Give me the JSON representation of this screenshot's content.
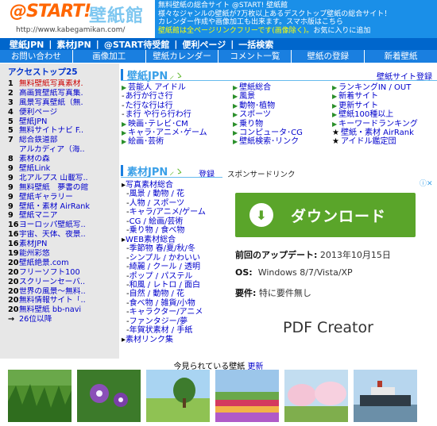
{
  "header": {
    "logo_start": "@START!",
    "logo_kanji": "壁紙館",
    "url": "http://www.kabegamikan.com/",
    "info_lines": [
      "無料壁紙の総合サイト @START! 壁紙館",
      "様々なジャンルの壁紙が7万枚以上あるデスクトップ壁紙の総合サイト！",
      "カレンダー作成や画像加工も出来ます。スマホ版はこちら"
    ],
    "info_line4_hl": "壁紙館は全ページリンクフリーです(画像除く)。",
    "info_line4_rest": "お気に入りに追加"
  },
  "nav1": [
    "壁紙JPN",
    "素材JPN",
    "@START待受館",
    "便利ページ",
    "一括検索"
  ],
  "nav2": [
    "お問い合わせ",
    "画像加工",
    "壁紙カレンダー",
    "コメント一覧",
    "壁紙の登録",
    "新着壁紙"
  ],
  "sidebar": {
    "title": "アクセストップ25",
    "items": [
      {
        "n": "1",
        "t": "無料壁紙写真素材."
      },
      {
        "n": "2",
        "t": "高画質壁紙写真集."
      },
      {
        "n": "3",
        "t": "風景写真壁紙（無."
      },
      {
        "n": "4",
        "t": "便利ページ"
      },
      {
        "n": "5",
        "t": "壁紙JPN"
      },
      {
        "n": "5",
        "t": "無料サイトナビ F.."
      },
      {
        "n": "7",
        "t": "総合鉄道部"
      },
      {
        "n": "",
        "t": "アルカディア（海.."
      },
      {
        "n": "8",
        "t": "素材の森"
      },
      {
        "n": "9",
        "t": "壁紙Link"
      },
      {
        "n": "9",
        "t": "北アルプス 山載写.."
      },
      {
        "n": "9",
        "t": "無料壁紙　夢書の館"
      },
      {
        "n": "9",
        "t": "壁紙ギャラリー"
      },
      {
        "n": "9",
        "t": "壁紙・素材 AirRank"
      },
      {
        "n": "9",
        "t": "壁紙マニア"
      },
      {
        "n": "16",
        "t": "ヨーロッパ壁紙写.."
      },
      {
        "n": "16",
        "t": "宇宙、天体、夜景.."
      },
      {
        "n": "16",
        "t": "素材JPN"
      },
      {
        "n": "19",
        "t": "能州彩悠"
      },
      {
        "n": "20",
        "t": "壁紙絶景.com"
      },
      {
        "n": "20",
        "t": "フリーソフト100"
      },
      {
        "n": "20",
        "t": "スクリーンセーバ.."
      },
      {
        "n": "20",
        "t": "世界の風景～無料.."
      },
      {
        "n": "20",
        "t": "無料情報サイト「.."
      },
      {
        "n": "20",
        "t": "無料壁紙 bb-navi"
      },
      {
        "n": "→",
        "t": "26位以降"
      }
    ]
  },
  "kabegami": {
    "title": "壁紙JPN",
    "register": "壁紙サイト登録",
    "col1": [
      {
        "p": "tri",
        "t": "芸能人 アイドル"
      },
      {
        "p": "dash",
        "t": "あ行か行さ行"
      },
      {
        "p": "dash",
        "t": "た行な行は行"
      },
      {
        "p": "dash",
        "t": "ま行 や行ら行わ行"
      },
      {
        "p": "tri",
        "t": "映画･テレビ･CM"
      },
      {
        "p": "tri",
        "t": "キャラ･アニメ･ゲーム"
      },
      {
        "p": "tri",
        "t": "絵画･芸術"
      }
    ],
    "col2": [
      {
        "p": "tri",
        "t": "壁紙総合"
      },
      {
        "p": "tri",
        "t": "風景"
      },
      {
        "p": "tri",
        "t": "動物･植物"
      },
      {
        "p": "tri",
        "t": "スポーツ"
      },
      {
        "p": "tri",
        "t": "乗り物"
      },
      {
        "p": "tri",
        "t": "コンピュータ･CG"
      },
      {
        "p": "tri",
        "t": "壁紙検索･リンク"
      }
    ],
    "col3": [
      {
        "p": "tri",
        "t": "ランキングIN / OUT"
      },
      {
        "p": "tri",
        "t": "新着サイト"
      },
      {
        "p": "tri",
        "t": "更新サイト"
      },
      {
        "p": "tri",
        "t": "壁紙100種以上"
      },
      {
        "p": "tri",
        "t": "キーワードランキング"
      },
      {
        "p": "star",
        "t": "壁紙・素材 AirRank"
      },
      {
        "p": "star",
        "t": "アイドル鑑定団"
      }
    ]
  },
  "sozai": {
    "title": "素材JPN",
    "register": "登録",
    "items": [
      {
        "p": "top",
        "t": "写真素材総合"
      },
      {
        "p": "sub",
        "t": "風景 / 動物 / 花"
      },
      {
        "p": "sub",
        "t": "人物 / スポーツ"
      },
      {
        "p": "sub",
        "t": "キャラ/アニメ/ゲーム"
      },
      {
        "p": "sub",
        "t": "CG / 絵画/芸術"
      },
      {
        "p": "sub",
        "t": "乗り物 / 食べ物"
      },
      {
        "p": "top",
        "t": "WEB素材総合"
      },
      {
        "p": "sub",
        "t": "季節物 春/夏/秋/冬"
      },
      {
        "p": "sub",
        "t": "シンプル / かわいい"
      },
      {
        "p": "sub",
        "t": "綺麗 / クール / 透明"
      },
      {
        "p": "sub",
        "t": "ポップ / パステル"
      },
      {
        "p": "sub",
        "t": "和風 / レトロ / 面白"
      },
      {
        "p": "sub",
        "t": "自然 / 動物 / 花"
      },
      {
        "p": "sub",
        "t": "食べ物 / 雑貨/小物"
      },
      {
        "p": "sub",
        "t": "キャラクター/アニメ"
      },
      {
        "p": "sub",
        "t": "ファンタジー/夢"
      },
      {
        "p": "sub",
        "t": "年賀状素材 / 手紙"
      },
      {
        "p": "top",
        "t": "素材リンク集"
      }
    ]
  },
  "ad": {
    "sponsor": "スポンサードリンク",
    "mark": "ⓘ✕",
    "button": "ダウンロード",
    "update_label": "前回のアップデート:",
    "update_value": "2013年10月15日",
    "os_label": "OS:",
    "os_value": "Windows 8/7/Vista/XP",
    "req_label": "要件:",
    "req_value": "特に要件無し",
    "product": "PDF Creator"
  },
  "bottom": {
    "title": "今見られている壁紙",
    "link": "更新"
  }
}
